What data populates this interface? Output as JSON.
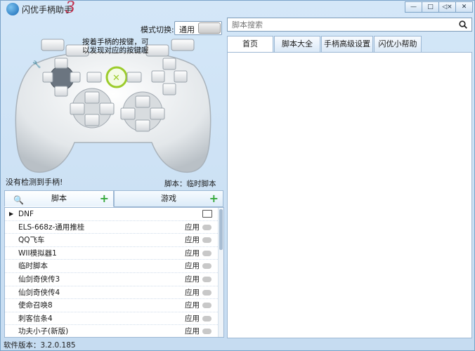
{
  "window": {
    "title": "闪优手柄助手",
    "title_version_mark": "3",
    "minimize_label": "—",
    "restore_label": "□",
    "mute_label": "◁×",
    "close_label": "✕"
  },
  "mode": {
    "label": "模式切换:",
    "value": "通用"
  },
  "controller": {
    "hint_line1": "按着手柄的按键，可",
    "hint_line2": "以发现对应的按键喔"
  },
  "status": {
    "no_device": "没有检测到手柄!",
    "script_label": "脚本：临时脚本"
  },
  "left_tabs": [
    {
      "label": "脚本",
      "plus": "+"
    },
    {
      "label": "游戏",
      "plus": "+"
    }
  ],
  "script_list": {
    "group": "DNF",
    "items": [
      {
        "name": "ELS-668z-通用推桂",
        "action": "应用"
      },
      {
        "name": "QQ飞车",
        "action": "应用"
      },
      {
        "name": "WII模拟器1",
        "action": "应用"
      },
      {
        "name": "临时脚本",
        "action": "应用"
      },
      {
        "name": "仙剑奇侠传3",
        "action": "应用"
      },
      {
        "name": "仙剑奇侠传4",
        "action": "应用"
      },
      {
        "name": "使命召唤8",
        "action": "应用"
      },
      {
        "name": "刺客信条4",
        "action": "应用"
      },
      {
        "name": "功夫小子(新版)",
        "action": "应用"
      }
    ]
  },
  "search": {
    "placeholder": "脚本搜索"
  },
  "right_tabs": [
    "首页",
    "脚本大全",
    "手柄高级设置",
    "闪优小帮助"
  ],
  "statusbar": {
    "version": "软件版本：3.2.0.185"
  },
  "colors": {
    "accent_green": "#35a83a",
    "xbox_green": "#9ccc2b",
    "window_bg": "#d4e7f8"
  }
}
